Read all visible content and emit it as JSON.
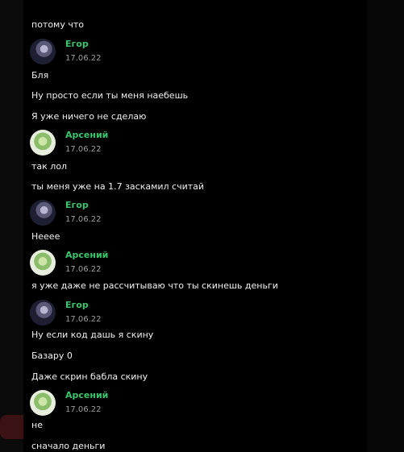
{
  "colors": {
    "background": "#0b0b0c",
    "chat_background": "#000000",
    "name_color": "#39c46b",
    "text_color": "#f0f0f0",
    "date_color": "#9b9b9b"
  },
  "messages": [
    {
      "text": "потому что"
    },
    {
      "author": "Егор",
      "date": "17.06.22",
      "avatar": "egor-avatar"
    },
    {
      "text": "Бля"
    },
    {
      "text": "Ну просто если ты меня наебешь"
    },
    {
      "text": "Я уже ничего не сделаю"
    },
    {
      "author": "Арсений",
      "date": "17.06.22",
      "avatar": "arseniy-avatar"
    },
    {
      "text": "так лол"
    },
    {
      "text": "ты меня уже на 1.7 заскамил считай"
    },
    {
      "author": "Егор",
      "date": "17.06.22",
      "avatar": "egor-avatar"
    },
    {
      "text": "Неееe"
    },
    {
      "author": "Арсений",
      "date": "17.06.22",
      "avatar": "arseniy-avatar"
    },
    {
      "text": "я уже даже не рассчитываю что ты скинешь деньги"
    },
    {
      "author": "Егор",
      "date": "17.06.22",
      "avatar": "egor-avatar"
    },
    {
      "text": "Ну если код дашь я скину"
    },
    {
      "text": "Базару 0"
    },
    {
      "text": "Даже скрин бабла скину"
    },
    {
      "author": "Арсений",
      "date": "17.06.22",
      "avatar": "arseniy-avatar"
    },
    {
      "text": "не"
    },
    {
      "text": "сначало деньги"
    }
  ]
}
